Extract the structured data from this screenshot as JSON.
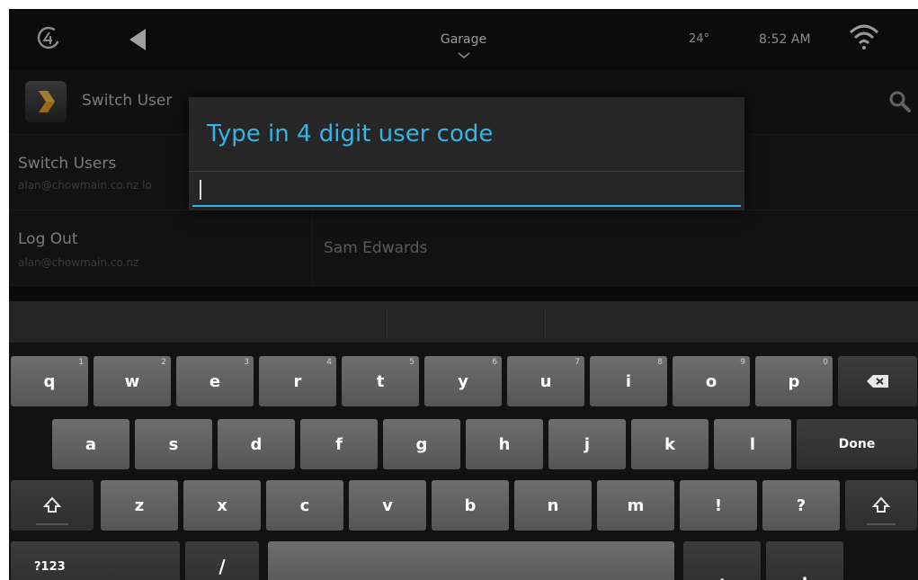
{
  "status_bar": {
    "room": "Garage",
    "temperature": "24°",
    "time": "8:52 AM",
    "icons": [
      "control4-logo-icon",
      "back-icon",
      "chevron-down-icon",
      "wifi-icon"
    ]
  },
  "action_bar": {
    "title": "Switch User",
    "icons": [
      "app-icon",
      "search-icon"
    ]
  },
  "list": {
    "switch_users": {
      "title": "Switch Users",
      "subtitle": "alan@chowmain.co.nz lo"
    },
    "log_out": {
      "title": "Log Out",
      "subtitle": "alan@chowmain.co.nz"
    },
    "right_item": "Sam Edwards"
  },
  "dialog": {
    "title": "Type in 4 digit user code",
    "input_value": ""
  },
  "keyboard": {
    "row1": [
      {
        "label": "q",
        "hint": "1"
      },
      {
        "label": "w",
        "hint": "2"
      },
      {
        "label": "e",
        "hint": "3"
      },
      {
        "label": "r",
        "hint": "4"
      },
      {
        "label": "t",
        "hint": "5"
      },
      {
        "label": "y",
        "hint": "6"
      },
      {
        "label": "u",
        "hint": "7"
      },
      {
        "label": "i",
        "hint": "8"
      },
      {
        "label": "o",
        "hint": "9"
      },
      {
        "label": "p",
        "hint": "0"
      }
    ],
    "row2": [
      "a",
      "s",
      "d",
      "f",
      "g",
      "h",
      "j",
      "k",
      "l"
    ],
    "row3": [
      "z",
      "x",
      "c",
      "v",
      "b",
      "n",
      "m",
      "!",
      "?"
    ],
    "done_label": "Done",
    "symbols_label": "?123",
    "slash_label": "/",
    "comma_label": ",",
    "period_label": ".",
    "icons": [
      "backspace-icon",
      "shift-icon"
    ]
  },
  "colors": {
    "accent": "#33b5e5",
    "background": "#101010",
    "key_light": "#666666",
    "key_dark": "#333333"
  }
}
